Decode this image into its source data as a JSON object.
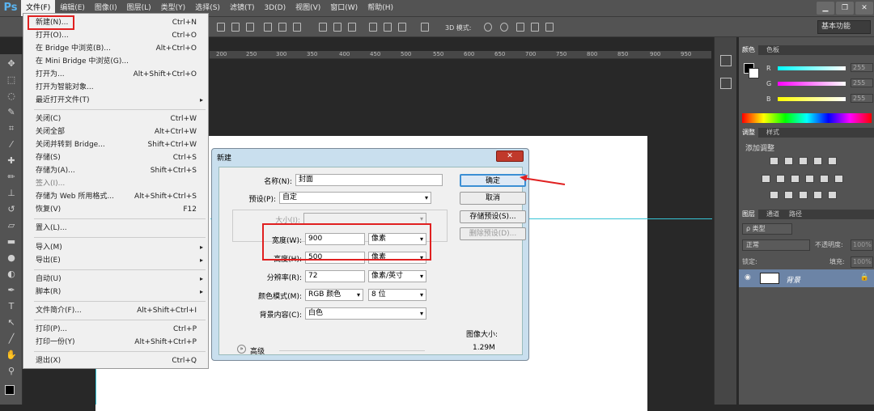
{
  "menubar": {
    "logo": "Ps",
    "items": [
      "文件(F)",
      "编辑(E)",
      "图像(I)",
      "图层(L)",
      "类型(Y)",
      "选择(S)",
      "滤镜(T)",
      "3D(D)",
      "视图(V)",
      "窗口(W)",
      "帮助(H)"
    ]
  },
  "window": {
    "minimize": "▁",
    "restore": "❐",
    "close": "✕"
  },
  "optbar": {
    "mode3d": "3D 模式:",
    "workspace": "基本功能"
  },
  "ruler": [
    "200",
    "250",
    "300",
    "350",
    "400",
    "450",
    "500",
    "550",
    "600",
    "650",
    "700",
    "750",
    "800",
    "850",
    "900",
    "950"
  ],
  "file_menu": [
    {
      "label": "新建(N)...",
      "shortcut": "Ctrl+N"
    },
    {
      "label": "打开(O)...",
      "shortcut": "Ctrl+O"
    },
    {
      "label": "在 Bridge 中浏览(B)...",
      "shortcut": "Alt+Ctrl+O"
    },
    {
      "label": "在 Mini Bridge 中浏览(G)...",
      "shortcut": ""
    },
    {
      "label": "打开为...",
      "shortcut": "Alt+Shift+Ctrl+O"
    },
    {
      "label": "打开为智能对象...",
      "shortcut": ""
    },
    {
      "label": "最近打开文件(T)",
      "shortcut": "",
      "arrow": "▸"
    },
    {
      "label": "关闭(C)",
      "shortcut": "Ctrl+W"
    },
    {
      "label": "关闭全部",
      "shortcut": "Alt+Ctrl+W"
    },
    {
      "label": "关闭并转到 Bridge...",
      "shortcut": "Shift+Ctrl+W"
    },
    {
      "label": "存储(S)",
      "shortcut": "Ctrl+S"
    },
    {
      "label": "存储为(A)...",
      "shortcut": "Shift+Ctrl+S"
    },
    {
      "label": "签入(I)...",
      "shortcut": ""
    },
    {
      "label": "存储为 Web 所用格式...",
      "shortcut": "Alt+Shift+Ctrl+S"
    },
    {
      "label": "恢复(V)",
      "shortcut": "F12"
    },
    {
      "label": "置入(L)...",
      "shortcut": ""
    },
    {
      "label": "导入(M)",
      "shortcut": "",
      "arrow": "▸"
    },
    {
      "label": "导出(E)",
      "shortcut": "",
      "arrow": "▸"
    },
    {
      "label": "自动(U)",
      "shortcut": "",
      "arrow": "▸"
    },
    {
      "label": "脚本(R)",
      "shortcut": "",
      "arrow": "▸"
    },
    {
      "label": "文件简介(F)...",
      "shortcut": "Alt+Shift+Ctrl+I"
    },
    {
      "label": "打印(P)...",
      "shortcut": "Ctrl+P"
    },
    {
      "label": "打印一份(Y)",
      "shortcut": "Alt+Shift+Ctrl+P"
    },
    {
      "label": "退出(X)",
      "shortcut": "Ctrl+Q"
    }
  ],
  "dialog": {
    "title": "新建",
    "close": "✕",
    "name_label": "名称(N):",
    "name_value": "封面",
    "preset_label": "预设(P):",
    "preset_value": "自定",
    "size_label": "大小(I):",
    "size_value": "",
    "width_label": "宽度(W):",
    "width_value": "900",
    "width_unit": "像素",
    "height_label": "高度(H):",
    "height_value": "500",
    "height_unit": "像素",
    "res_label": "分辨率(R):",
    "res_value": "72",
    "res_unit": "像素/英寸",
    "mode_label": "颜色模式(M):",
    "mode_value": "RGB 颜色",
    "depth_value": "8 位",
    "bg_label": "背景内容(C):",
    "bg_value": "白色",
    "advanced": "高级",
    "ok": "确定",
    "cancel": "取消",
    "save_preset": "存储预设(S)...",
    "delete_preset": "删除预设(D)...",
    "imgsize_label": "图像大小:",
    "imgsize_value": "1.29M"
  },
  "color_panel": {
    "tab1": "颜色",
    "tab2": "色板",
    "r_label": "R",
    "g_label": "G",
    "b_label": "B",
    "r": "255",
    "g": "255",
    "b": "255"
  },
  "adjust_panel": {
    "tab1": "调整",
    "tab2": "样式",
    "title": "添加调整"
  },
  "layers_panel": {
    "tab1": "图层",
    "tab2": "通道",
    "tab3": "路径",
    "kind": "ρ 类型",
    "blend": "正常",
    "opacity_label": "不透明度:",
    "opacity": "100%",
    "lock_label": "锁定:",
    "fill_label": "填充:",
    "fill": "100%",
    "layer_name": "背景"
  },
  "colors": {
    "accent": "#e02020",
    "guide": "#36c4d6",
    "layer_selected": "#6c84a6"
  }
}
